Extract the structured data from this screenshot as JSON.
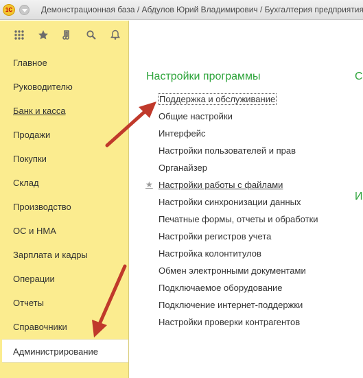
{
  "window": {
    "logo": "1С",
    "title": "Демонстрационная база / Абдулов Юрий Владимирович / Бухгалтерия предприятия (учебна"
  },
  "toolbar": {
    "icons": [
      "apps-grid-icon",
      "star-icon",
      "history-icon",
      "search-icon",
      "bell-icon"
    ]
  },
  "sidebar": {
    "items": [
      {
        "label": "Главное"
      },
      {
        "label": "Руководителю"
      },
      {
        "label": "Банк и касса"
      },
      {
        "label": "Продажи"
      },
      {
        "label": "Покупки"
      },
      {
        "label": "Склад"
      },
      {
        "label": "Производство"
      },
      {
        "label": "ОС и НМА"
      },
      {
        "label": "Зарплата и кадры"
      },
      {
        "label": "Операции"
      },
      {
        "label": "Отчеты"
      },
      {
        "label": "Справочники"
      },
      {
        "label": "Администрирование"
      }
    ],
    "active_index": 12
  },
  "main": {
    "section_title": "Настройки программы",
    "section_title_2": "С",
    "section_title_3": "И",
    "links": [
      {
        "label": "Поддержка и обслуживание"
      },
      {
        "label": "Общие настройки"
      },
      {
        "label": "Интерфейс"
      },
      {
        "label": "Настройки пользователей и прав"
      },
      {
        "label": "Органайзер"
      },
      {
        "label": "Настройки работы с файлами"
      },
      {
        "label": "Настройки синхронизации данных"
      },
      {
        "label": "Печатные формы, отчеты и обработки"
      },
      {
        "label": "Настройки регистров учета"
      },
      {
        "label": "Настройка колонтитулов"
      },
      {
        "label": "Обмен электронными документами"
      },
      {
        "label": "Подключаемое оборудование"
      },
      {
        "label": "Подключение интернет-поддержки"
      },
      {
        "label": "Настройки проверки контрагентов"
      }
    ]
  },
  "colors": {
    "sidebar_bg": "#fbec8f",
    "section_title": "#2ea43b",
    "annotation_arrow": "#c0392b"
  }
}
